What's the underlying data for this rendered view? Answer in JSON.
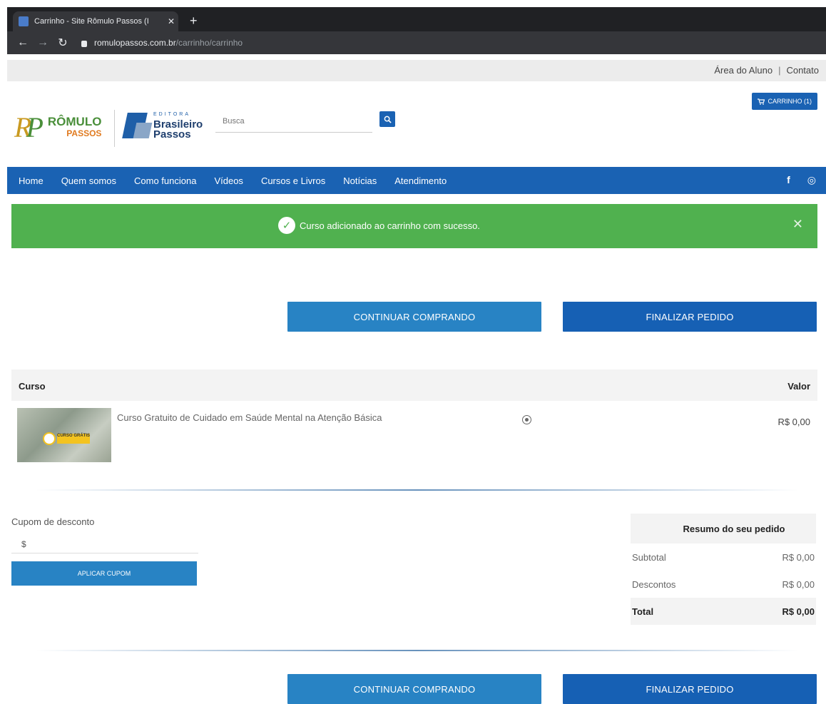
{
  "browser": {
    "tab_title": "Carrinho - Site Rômulo Passos (I",
    "tab_close": "✕",
    "new_tab": "+",
    "url_host": "romulopassos.com.br",
    "url_path": "/carrinho/carrinho"
  },
  "topbar": {
    "area_aluno": "Área do Aluno",
    "separator": "|",
    "contato": "Contato"
  },
  "header": {
    "logo1_line1": "RÔMULO",
    "logo1_line2": "PASSOS",
    "logo2_small": "EDITORA",
    "logo2_line1": "Brasileiro",
    "logo2_line2": "Passos",
    "search_placeholder": "Busca",
    "cart_label": "CARRINHO (1)"
  },
  "nav": {
    "items": [
      "Home",
      "Quem somos",
      "Como funciona",
      "Vídeos",
      "Cursos e Livros",
      "Notícias",
      "Atendimento"
    ],
    "facebook": "f",
    "instagram": "◎"
  },
  "alert": {
    "message": "Curso adicionado ao carrinho com sucesso.",
    "close": "✕"
  },
  "actions": {
    "continue_label": "CONTINUAR COMPRANDO",
    "finish_label": "FINALIZAR PEDIDO"
  },
  "cart": {
    "col_course": "Curso",
    "col_value": "Valor",
    "item_title": "Curso Gratuito de Cuidado em Saúde Mental na Atenção Básica",
    "item_price": "R$ 0,00",
    "thumb_tag": "CURSO GRÁTIS"
  },
  "coupon": {
    "label": "Cupom de desconto",
    "value": "$",
    "button": "APLICAR CUPOM"
  },
  "summary": {
    "title": "Resumo do seu pedido",
    "subtotal_label": "Subtotal",
    "subtotal_value": "R$ 0,00",
    "discount_label": "Descontos",
    "discount_value": "R$ 0,00",
    "total_label": "Total",
    "total_value": "R$ 0,00"
  }
}
